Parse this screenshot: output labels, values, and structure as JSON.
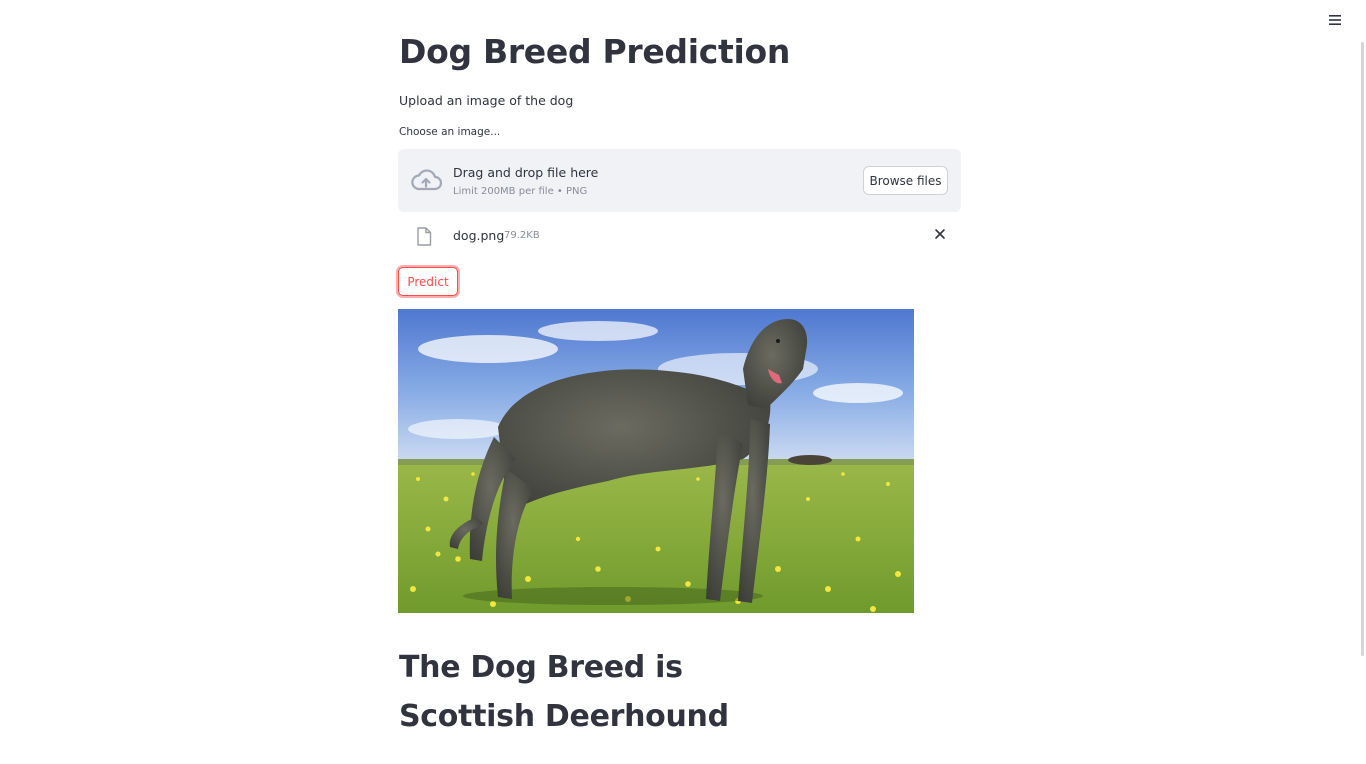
{
  "page": {
    "title": "Dog Breed Prediction",
    "subtitle": "Upload an image of the dog"
  },
  "uploader": {
    "label": "Choose an image...",
    "drop_text": "Drag and drop file here",
    "limit_text": "Limit 200MB per file • PNG",
    "browse_label": "Browse files",
    "cloud_icon": "cloud-upload-icon"
  },
  "file": {
    "name": "dog.png",
    "size": "79.2KB",
    "file_icon": "file-icon",
    "remove_icon": "close-icon"
  },
  "predict": {
    "label": "Predict",
    "accent_color": "#ff4b4b"
  },
  "image": {
    "subject": "Scottish Deerhound standing in a grassy field with yellow flowers under a blue cloudy sky"
  },
  "result": {
    "text": "The Dog Breed is Scottish Deerhound"
  },
  "menu": {
    "icon": "hamburger-menu-icon"
  },
  "colors": {
    "text": "#31333f",
    "muted": "#8a8c97",
    "dropzone_bg": "#f0f2f6",
    "accent": "#ff4b4b"
  }
}
